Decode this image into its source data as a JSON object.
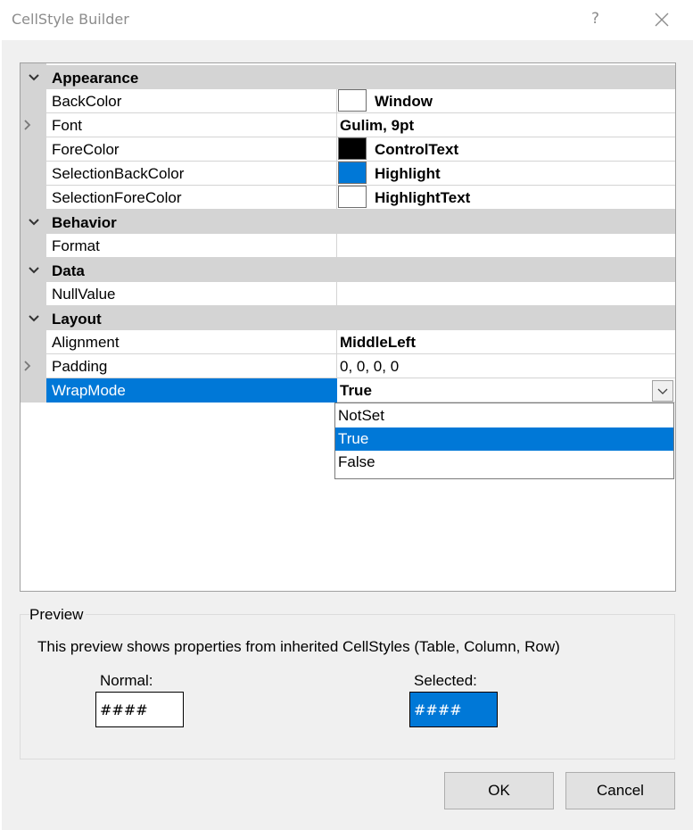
{
  "window": {
    "title": "CellStyle Builder",
    "help_label": "?",
    "close_icon": "close-icon"
  },
  "grid": {
    "categories": [
      {
        "label": "Appearance",
        "rows": [
          {
            "name": "BackColor",
            "value": "Window",
            "swatch": "#ffffff"
          },
          {
            "name": "Font",
            "value": "Gulim, 9pt",
            "expandable": true
          },
          {
            "name": "ForeColor",
            "value": "ControlText",
            "swatch": "#000000"
          },
          {
            "name": "SelectionBackColor",
            "value": "Highlight",
            "swatch": "#0078d7"
          },
          {
            "name": "SelectionForeColor",
            "value": "HighlightText",
            "swatch": "#ffffff"
          }
        ]
      },
      {
        "label": "Behavior",
        "rows": [
          {
            "name": "Format",
            "value": ""
          }
        ]
      },
      {
        "label": "Data",
        "rows": [
          {
            "name": "NullValue",
            "value": ""
          }
        ]
      },
      {
        "label": "Layout",
        "rows": [
          {
            "name": "Alignment",
            "value": "MiddleLeft"
          },
          {
            "name": "Padding",
            "value": "0, 0, 0, 0",
            "expandable": true
          },
          {
            "name": "WrapMode",
            "value": "True",
            "selected": true
          }
        ]
      }
    ],
    "wrapmode_dropdown": {
      "options": [
        "NotSet",
        "True",
        "False"
      ],
      "selected": "True"
    }
  },
  "preview": {
    "legend": "Preview",
    "description": "This preview shows properties from inherited CellStyles (Table, Column, Row)",
    "normal_label": "Normal:",
    "normal_sample": "####",
    "selected_label": "Selected:",
    "selected_sample": "####"
  },
  "buttons": {
    "ok": "OK",
    "cancel": "Cancel"
  },
  "colors": {
    "highlight": "#0078d7",
    "category_bg": "#d4d4d4"
  }
}
